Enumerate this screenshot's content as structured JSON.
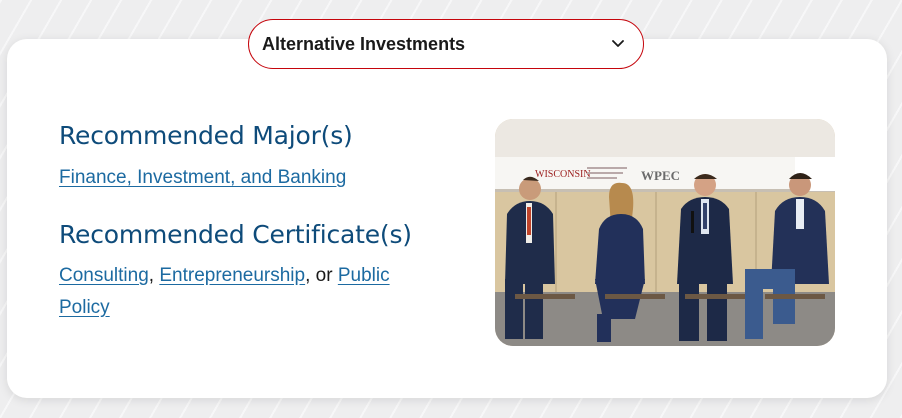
{
  "dropdown": {
    "selected": "Alternative Investments",
    "icon": "chevron-down-icon"
  },
  "majors": {
    "heading": "Recommended Major(s)",
    "links": [
      "Finance, Investment, and Banking"
    ]
  },
  "certificates": {
    "heading": "Recommended Certificate(s)",
    "link1": "Consulting",
    "sep1": ", ",
    "link2": "Entrepreneurship",
    "sep2": ", or ",
    "link3": "Public Policy"
  },
  "photo": {
    "banner_text1": "WISCONSIN",
    "banner_text2": "WPEC"
  },
  "colors": {
    "accent": "#c5050c",
    "heading": "#0e4b7a",
    "link": "#1c6aa1"
  }
}
